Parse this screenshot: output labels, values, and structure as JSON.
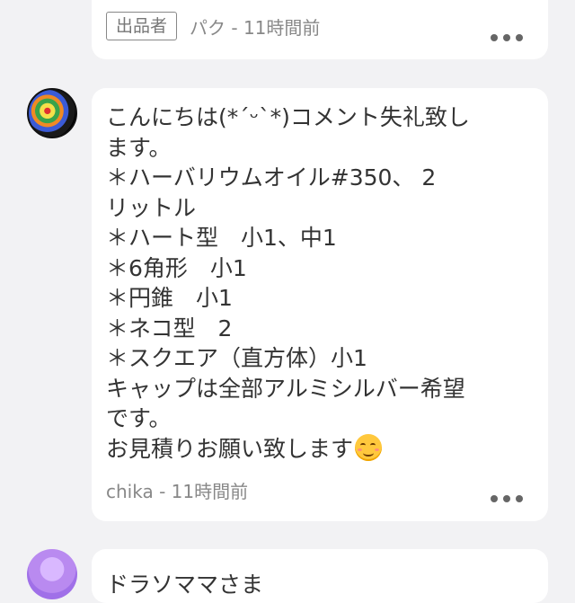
{
  "prev_comment": {
    "badge": "出品者",
    "author_time": "パク - 11時間前"
  },
  "comment": {
    "lines": [
      "こんにちは(*´ᵕ`*)コメント失礼致し",
      "ます。",
      "＊ハーバリウムオイル#350、 2",
      "リットル",
      "＊ハート型　小1、中1",
      "＊6角形　小1",
      "＊円錐　小1",
      "＊ネコ型　2",
      "＊スクエア（直方体）小1",
      "キャップは全部アルミシルバー希望",
      "です。",
      "お見積りお願い致します"
    ],
    "emoji_icon": "relieved-smiley-icon",
    "author_time": "chika - 11時間前"
  },
  "next_comment": {
    "partial_text": "ドラソママさま"
  }
}
